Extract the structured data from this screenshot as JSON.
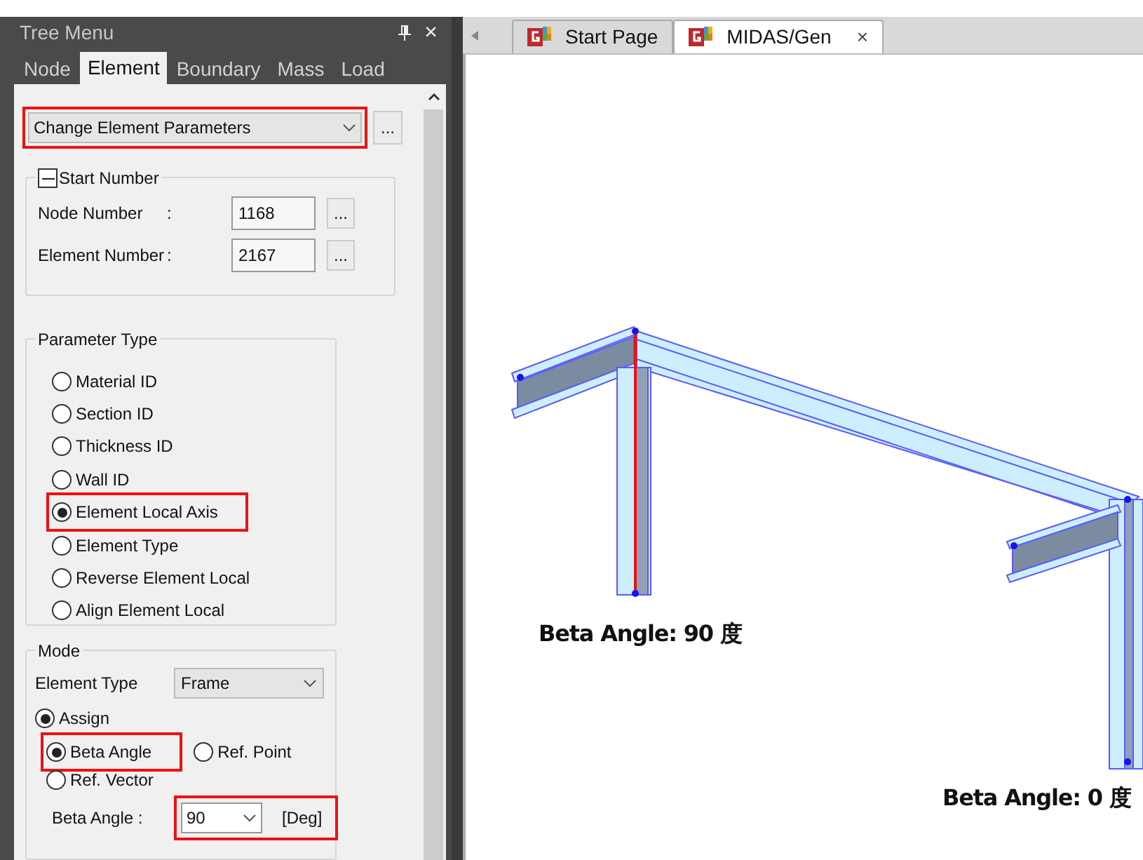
{
  "tree_menu": {
    "title": "Tree Menu",
    "close": "×",
    "tabs": [
      {
        "label": "Node",
        "selected": false
      },
      {
        "label": "Element",
        "selected": true
      },
      {
        "label": "Boundary",
        "selected": false
      },
      {
        "label": "Mass",
        "selected": false
      },
      {
        "label": "Load",
        "selected": false
      }
    ],
    "command": {
      "value": "Change Element Parameters",
      "highlighted": true,
      "button": "..."
    },
    "start_number": {
      "title": "Start Number",
      "expanded": true,
      "fields": [
        {
          "label": "Node Number",
          "colon": ":",
          "value": "1168",
          "button": "..."
        },
        {
          "label": "Element Number",
          "colon": ":",
          "value": "2167",
          "button": "..."
        }
      ]
    },
    "parameter_type": {
      "title": "Parameter Type",
      "options": [
        {
          "label": "Material ID",
          "selected": false,
          "highlighted": false
        },
        {
          "label": "Section ID",
          "selected": false,
          "highlighted": false
        },
        {
          "label": "Thickness ID",
          "selected": false,
          "highlighted": false
        },
        {
          "label": "Wall ID",
          "selected": false,
          "highlighted": false
        },
        {
          "label": "Element Local Axis",
          "selected": true,
          "highlighted": true
        },
        {
          "label": "Element Type",
          "selected": false,
          "highlighted": false
        },
        {
          "label": "Reverse Element Local",
          "selected": false,
          "highlighted": false
        },
        {
          "label": "Align Element Local",
          "selected": false,
          "highlighted": false
        }
      ]
    },
    "mode": {
      "title": "Mode",
      "element_type": {
        "label": "Element Type",
        "value": "Frame"
      },
      "actions": [
        {
          "label": "Assign",
          "selected": true
        }
      ],
      "options": [
        {
          "label": "Beta Angle",
          "selected": true,
          "highlighted": true
        },
        {
          "label": "Ref. Point",
          "selected": false,
          "highlighted": false
        },
        {
          "label": "Ref. Vector",
          "selected": false,
          "highlighted": false
        }
      ],
      "beta_angle": {
        "label": "Beta Angle :",
        "value": "90",
        "unit": "[Deg]",
        "highlighted": true
      }
    }
  },
  "viewport": {
    "tabs": [
      {
        "label": "Start Page",
        "selected": false,
        "closable": false
      },
      {
        "label": "MIDAS/Gen",
        "selected": true,
        "closable": true
      }
    ],
    "close": "×",
    "annotations": [
      "Beta Angle: 90 度",
      "Beta Angle: 0 度"
    ]
  }
}
